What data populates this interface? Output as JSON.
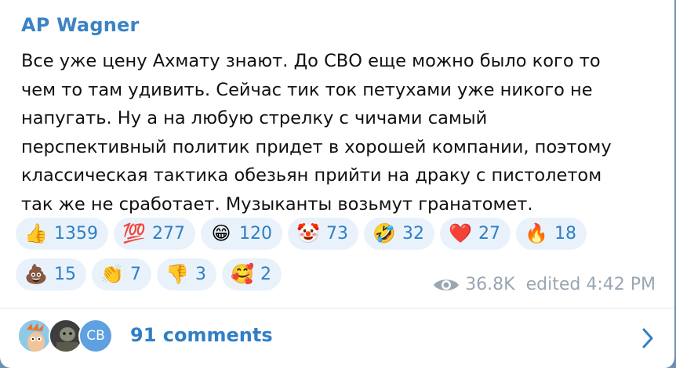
{
  "post": {
    "author": "AP Wagner",
    "text_lines": [
      "Все уже цену Ахмату знают. До СВО еще можно было кого то",
      "чем то там удивить. Сейчас тик ток петухами уже никого не",
      "напугать. Ну а на любую стрелку с чичами самый",
      "перспективный политик придет в хорошей компании, поэтому",
      "классическая тактика обезьян прийти на драку с пистолетом",
      "так же не сработает. Музыканты возьмут гранатомет."
    ]
  },
  "reactions": [
    {
      "emoji": "👍",
      "icon": "thumbs-up-icon",
      "count": "1359"
    },
    {
      "emoji": "💯",
      "icon": "hundred-points-icon",
      "count": "277"
    },
    {
      "emoji": "😁",
      "icon": "grinning-face-icon",
      "count": "120"
    },
    {
      "emoji": "🤡",
      "icon": "clown-face-icon",
      "count": "73"
    },
    {
      "emoji": "🤣",
      "icon": "rofl-face-icon",
      "count": "32"
    },
    {
      "emoji": "❤️",
      "icon": "red-heart-icon",
      "count": "27"
    },
    {
      "emoji": "🔥",
      "icon": "fire-icon",
      "count": "18"
    },
    {
      "emoji": "💩",
      "icon": "pile-of-poo-icon",
      "count": "15"
    },
    {
      "emoji": "👏",
      "icon": "clapping-hands-icon",
      "count": "7"
    },
    {
      "emoji": "👎",
      "icon": "thumbs-down-icon",
      "count": "3"
    },
    {
      "emoji": "🥰",
      "icon": "smiling-face-hearts-icon",
      "count": "2"
    }
  ],
  "meta": {
    "views": "36.8K",
    "edited": "edited 4:42 PM"
  },
  "footer": {
    "avatars": [
      "",
      "",
      "CB"
    ],
    "comments_label": "91 comments"
  },
  "colors": {
    "accent": "#2f7fc5",
    "author": "#3a83c4",
    "pill_bg": "#e9f2fb",
    "meta": "#9aa6b2"
  }
}
